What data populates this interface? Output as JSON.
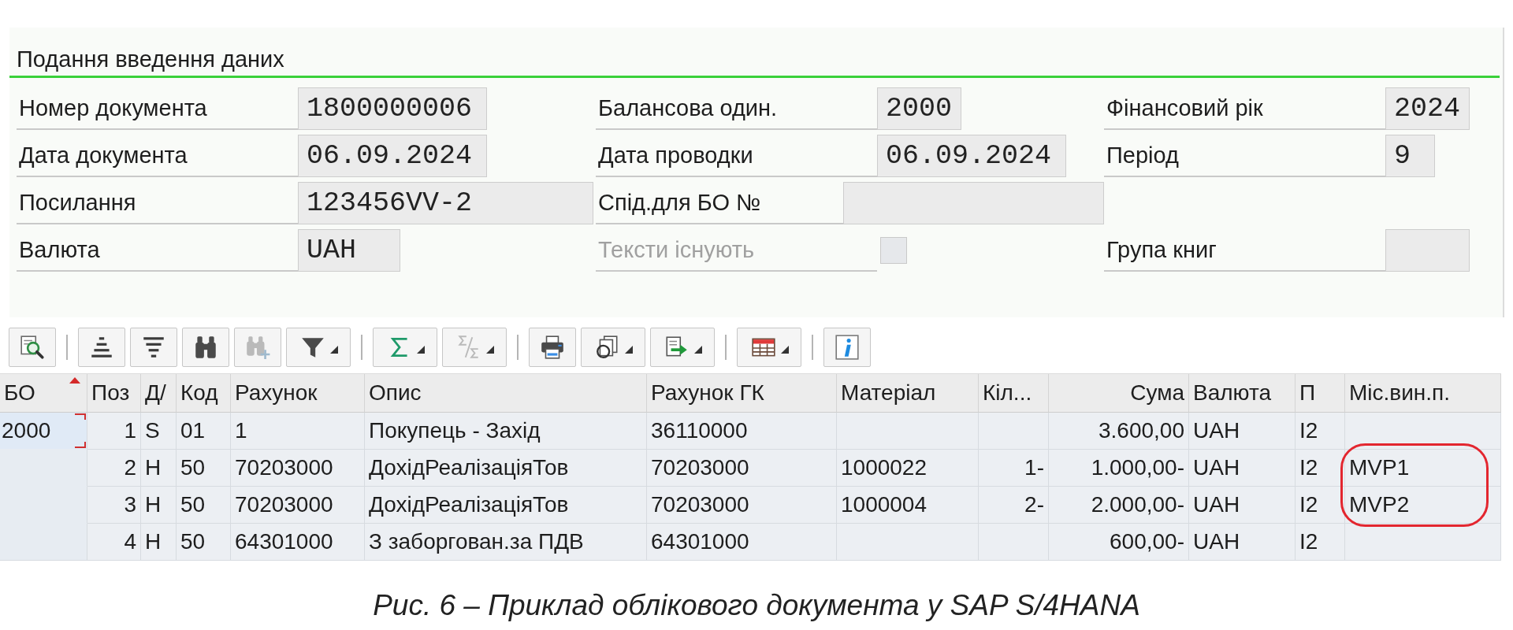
{
  "form": {
    "title": "Подання введення даних",
    "rows": [
      [
        {
          "kind": "text",
          "label": "Номер документа",
          "value": "1800000006",
          "disabled": false
        },
        {
          "kind": "text",
          "label": "Балансова один.",
          "value": "2000",
          "disabled": false
        },
        {
          "kind": "text",
          "label": "Фінансовий рік",
          "value": "2024",
          "disabled": false
        }
      ],
      [
        {
          "kind": "text",
          "label": "Дата документа",
          "value": "06.09.2024",
          "disabled": false
        },
        {
          "kind": "text",
          "label": "Дата проводки",
          "value": "06.09.2024",
          "disabled": false
        },
        {
          "kind": "text",
          "label": "Період",
          "value": "9",
          "disabled": false
        }
      ],
      [
        {
          "kind": "text",
          "label": "Посилання",
          "value": "123456VV-2",
          "disabled": false
        },
        {
          "kind": "text",
          "label": "Спід.для БО №",
          "disabled": false
        }
      ],
      [
        {
          "kind": "text",
          "label": "Валюта",
          "value": "UAH",
          "disabled": false
        },
        {
          "kind": "checkbox",
          "label": "Тексти існують",
          "checked": false,
          "disabled": true
        },
        {
          "kind": "text",
          "label": "Група книг",
          "disabled": false
        }
      ]
    ]
  },
  "toolbar": {
    "groups": [
      [
        {
          "kind": "details",
          "disabled": false,
          "menu": false
        }
      ],
      [
        {
          "kind": "sort-ascending",
          "disabled": false,
          "menu": false
        },
        {
          "kind": "sort-descending",
          "disabled": false,
          "menu": false
        },
        {
          "kind": "find",
          "disabled": false,
          "menu": false
        },
        {
          "kind": "find-next",
          "disabled": true,
          "menu": false
        },
        {
          "kind": "filter",
          "disabled": false,
          "menu": true
        }
      ],
      [
        {
          "kind": "total",
          "disabled": false,
          "menu": true
        },
        {
          "kind": "subtotal",
          "disabled": true,
          "menu": true
        }
      ],
      [
        {
          "kind": "print",
          "disabled": false,
          "menu": false
        },
        {
          "kind": "views",
          "disabled": false,
          "menu": true
        },
        {
          "kind": "export",
          "disabled": false,
          "menu": true
        }
      ],
      [
        {
          "kind": "layout",
          "disabled": false,
          "menu": true
        }
      ],
      [
        {
          "kind": "info",
          "disabled": false,
          "menu": false
        }
      ]
    ]
  },
  "table": {
    "columns": [
      {
        "label": "БО",
        "sorted": true
      },
      {
        "label": "Поз",
        "sorted": false
      },
      {
        "label": "Д/",
        "sorted": false
      },
      {
        "label": "Код",
        "sorted": false
      },
      {
        "label": "Рахунок",
        "sorted": false
      },
      {
        "label": "Опис",
        "sorted": false
      },
      {
        "label": "Рахунок ГК",
        "sorted": false
      },
      {
        "label": "Матеріал",
        "sorted": false
      },
      {
        "label": "Кіл...",
        "sorted": false
      },
      {
        "label": "Сума",
        "sorted": false
      },
      {
        "label": "Валюта",
        "sorted": false
      },
      {
        "label": "П",
        "sorted": false
      },
      {
        "label": "Міс.вин.п.",
        "sorted": false
      }
    ],
    "rows": [
      {
        "focused": true,
        "circled": false,
        "company_code": "2000",
        "item": "1",
        "debit_credit": "S",
        "posting_key": "01",
        "account": "1",
        "description": "Покупець - Захід",
        "gl_account": "36110000",
        "amount": "3.600,00",
        "currency": "UAH",
        "tax_code": "I2"
      },
      {
        "focused": false,
        "circled": true,
        "item": "2",
        "debit_credit": "H",
        "posting_key": "50",
        "account": "70203000",
        "description": "ДохідРеалізаціяТов",
        "gl_account": "70203000",
        "material": "1000022",
        "quantity": "1-",
        "amount": "1.000,00-",
        "currency": "UAH",
        "tax_code": "I2",
        "profit_center": "MVP1"
      },
      {
        "focused": false,
        "circled": true,
        "item": "3",
        "debit_credit": "H",
        "posting_key": "50",
        "account": "70203000",
        "description": "ДохідРеалізаціяТов",
        "gl_account": "70203000",
        "material": "1000004",
        "quantity": "2-",
        "amount": "2.000,00-",
        "currency": "UAH",
        "tax_code": "I2",
        "profit_center": "MVP2"
      },
      {
        "focused": false,
        "circled": false,
        "item": "4",
        "debit_credit": "H",
        "posting_key": "50",
        "account": "64301000",
        "description": "З заборгован.за ПДВ",
        "gl_account": "64301000",
        "amount": "600,00-",
        "currency": "UAH",
        "tax_code": "I2"
      }
    ]
  },
  "caption": "Рис. 6 – Приклад облікового документа у SAP S/4HANA"
}
